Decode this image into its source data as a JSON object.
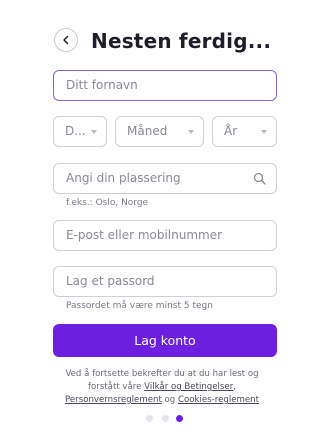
{
  "header": {
    "title": "Nesten ferdig..."
  },
  "form": {
    "first_name": {
      "placeholder": "Ditt fornavn"
    },
    "birth": {
      "day": "D...",
      "month": "Måned",
      "year": "År"
    },
    "location": {
      "placeholder": "Angi din plassering",
      "hint": "f.eks.: Oslo, Norge"
    },
    "contact": {
      "placeholder": "E-post eller mobilnummer"
    },
    "password": {
      "placeholder": "Lag et passord",
      "hint": "Passordet må være minst 5 tegn"
    },
    "submit_label": "Lag konto"
  },
  "terms": {
    "line1": "Ved å fortsette bekrefter du at du har lest og",
    "line2_prefix": "forstått våre ",
    "link_terms": "Vilkår og Betingelser",
    "line2_suffix": ",",
    "link_privacy": "Personvernsreglement",
    "connector": " og ",
    "link_cookies": "Cookies-reglement"
  },
  "pagination": {
    "total": 3,
    "current": 3
  },
  "colors": {
    "accent": "#6d1fe0",
    "focus_border": "#8a63d2",
    "field_border": "#cfcfd6"
  }
}
